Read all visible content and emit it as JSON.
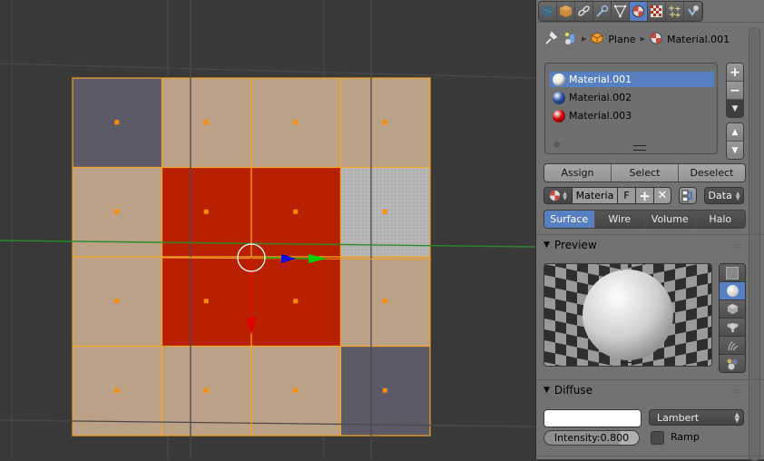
{
  "viewport": {
    "object_name": "Plane",
    "grid_faces": [
      [
        "gray",
        "tan",
        "tan",
        "tan"
      ],
      [
        "tan",
        "red",
        "red",
        "dotted"
      ],
      [
        "tan",
        "red",
        "red",
        "tan"
      ],
      [
        "tan",
        "tan",
        "tan",
        "gray"
      ]
    ],
    "face_colors": {
      "tan": "#bba186",
      "red": "#b82000",
      "gray": "#5c5a66",
      "dotted": "#b2b2b2",
      "edge": "#f5a425",
      "center_dot": "#ff8c00"
    }
  },
  "properties": {
    "tabs": [
      {
        "icon": "world-icon"
      },
      {
        "icon": "object-cube-icon"
      },
      {
        "icon": "constraints-chain-icon"
      },
      {
        "icon": "modifier-wrench-icon"
      },
      {
        "icon": "mesh-data-icon"
      },
      {
        "icon": "material-icon",
        "active": true
      },
      {
        "icon": "texture-checker-icon"
      },
      {
        "icon": "particles-icon"
      },
      {
        "icon": "physics-icon"
      }
    ],
    "breadcrumb": {
      "object": "Plane",
      "material": "Material.001"
    },
    "material_slots": [
      {
        "name": "Material.001",
        "color": "#e8e8e8",
        "selected": true
      },
      {
        "name": "Material.002",
        "color": "#2a4f9e",
        "selected": false
      },
      {
        "name": "Material.003",
        "color": "#d10000",
        "selected": false
      }
    ],
    "slot_buttons": {
      "add": "+",
      "remove": "−"
    },
    "assign_row": [
      "Assign",
      "Select",
      "Deselect"
    ],
    "material_field": {
      "name": "Materia",
      "fake_user": "F",
      "link": "Data"
    },
    "type_tabs": [
      {
        "label": "Surface",
        "active": true
      },
      {
        "label": "Wire",
        "active": false
      },
      {
        "label": "Volume",
        "active": false
      },
      {
        "label": "Halo",
        "active": false
      }
    ],
    "preview": {
      "title": "Preview"
    },
    "diffuse": {
      "title": "Diffuse",
      "color": "#ffffff",
      "shader": "Lambert",
      "intensity_label": "Intensity:",
      "intensity_value": "0.800",
      "intensity": 0.8,
      "ramp_label": "Ramp",
      "ramp_checked": false
    }
  }
}
